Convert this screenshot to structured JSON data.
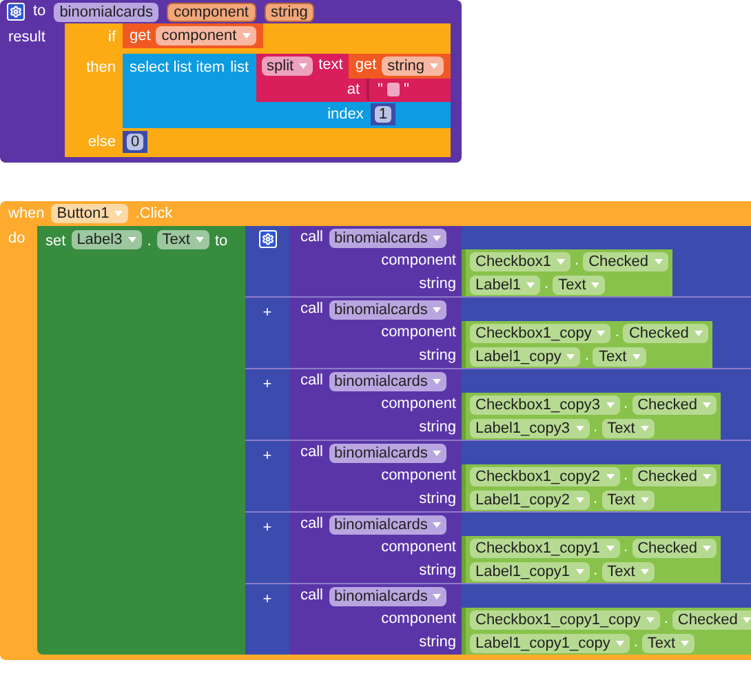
{
  "procedure": {
    "keyword": "to",
    "name": "binomialcards",
    "params": [
      "component",
      "string"
    ],
    "result_label": "result",
    "if_block": {
      "if_label": "if",
      "then_label": "then",
      "else_label": "else",
      "condition": {
        "get": "get",
        "variable": "component"
      },
      "then_value": {
        "label": "select list item",
        "list_label": "list",
        "split": {
          "op": "split",
          "text_label": "text",
          "get": "get",
          "variable": "string",
          "at_label": "at",
          "quote_open": "\"",
          "quote_close": "\""
        },
        "index_label": "index",
        "index": "1"
      },
      "else_value": "0"
    }
  },
  "event": {
    "when": "when",
    "component": "Button1",
    "event": ".Click",
    "do": "do",
    "set": {
      "label": "set",
      "component": "Label3",
      "dot": ".",
      "property": "Text",
      "to": "to"
    },
    "calls": [
      {
        "call": "call",
        "procedure": "binomialcards",
        "args": [
          {
            "label": "component",
            "component": "Checkbox1",
            "dot": ".",
            "property": "Checked"
          },
          {
            "label": "string",
            "component": "Label1",
            "dot": ".",
            "property": "Text"
          }
        ]
      },
      {
        "plus": "+",
        "call": "call",
        "procedure": "binomialcards",
        "args": [
          {
            "label": "component",
            "component": "Checkbox1_copy",
            "dot": ".",
            "property": "Checked"
          },
          {
            "label": "string",
            "component": "Label1_copy",
            "dot": ".",
            "property": "Text"
          }
        ]
      },
      {
        "plus": "+",
        "call": "call",
        "procedure": "binomialcards",
        "args": [
          {
            "label": "component",
            "component": "Checkbox1_copy3",
            "dot": ".",
            "property": "Checked"
          },
          {
            "label": "string",
            "component": "Label1_copy3",
            "dot": ".",
            "property": "Text"
          }
        ]
      },
      {
        "plus": "+",
        "call": "call",
        "procedure": "binomialcards",
        "args": [
          {
            "label": "component",
            "component": "Checkbox1_copy2",
            "dot": ".",
            "property": "Checked"
          },
          {
            "label": "string",
            "component": "Label1_copy2",
            "dot": ".",
            "property": "Text"
          }
        ]
      },
      {
        "plus": "+",
        "call": "call",
        "procedure": "binomialcards",
        "args": [
          {
            "label": "component",
            "component": "Checkbox1_copy1",
            "dot": ".",
            "property": "Checked"
          },
          {
            "label": "string",
            "component": "Label1_copy1",
            "dot": ".",
            "property": "Text"
          }
        ]
      },
      {
        "plus": "+",
        "call": "call",
        "procedure": "binomialcards",
        "args": [
          {
            "label": "component",
            "component": "Checkbox1_copy1_copy",
            "dot": ".",
            "property": "Checked"
          },
          {
            "label": "string",
            "component": "Label1_copy1_copy",
            "dot": ".",
            "property": "Text"
          }
        ]
      }
    ]
  }
}
